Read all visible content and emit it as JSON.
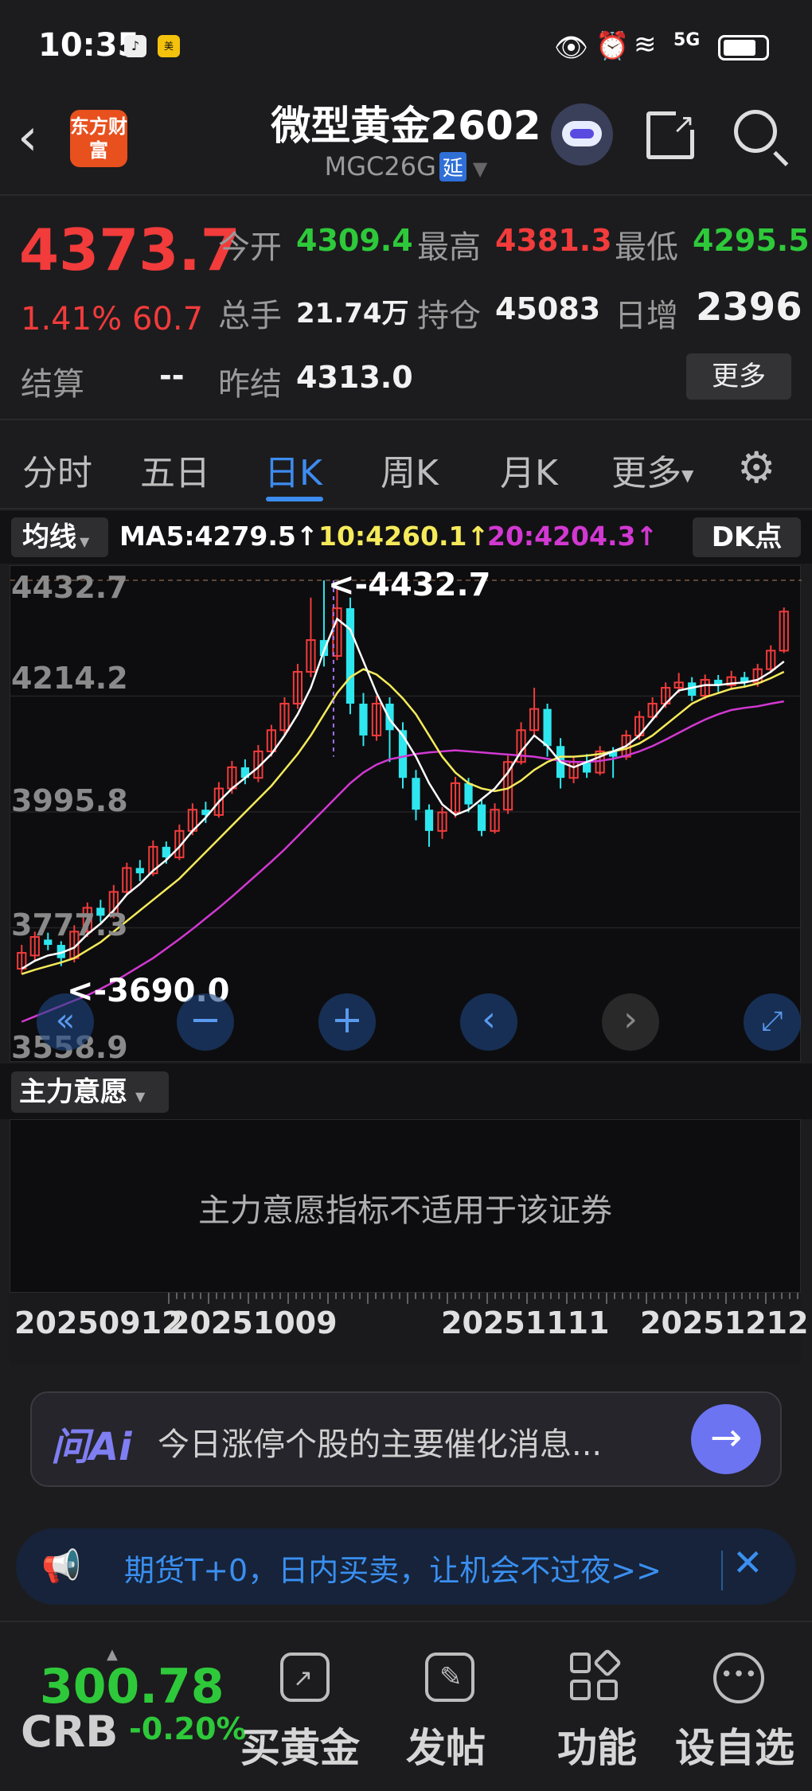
{
  "status": {
    "time": "10:35",
    "network": "5G"
  },
  "header": {
    "title": "微型黄金2602",
    "symbol": "MGC26G",
    "badge": "延",
    "logo_text": "东方财富"
  },
  "quote": {
    "price": "4373.7",
    "change_pct": "1.41%",
    "change": "60.7",
    "open_label": "今开",
    "open": "4309.4",
    "high_label": "最高",
    "high": "4381.3",
    "low_label": "最低",
    "low": "4295.5",
    "volume_label": "总手",
    "volume": "21.74万",
    "oi_label": "持仓",
    "oi": "45083",
    "daily_inc_label": "日增",
    "daily_inc": "2396",
    "settle_label": "结算",
    "settle": "--",
    "prev_settle_label": "昨结",
    "prev_settle": "4313.0",
    "more_label": "更多"
  },
  "tabs": [
    "分时",
    "五日",
    "日K",
    "周K",
    "月K",
    "更多"
  ],
  "active_tab": "日K",
  "ma": {
    "button": "均线",
    "ma5": "MA5:4279.5",
    "ma10": "10:4260.1",
    "ma20": "20:4204.3",
    "dk": "DK点"
  },
  "colors": {
    "up": "#f23b3b",
    "down": "#2ee6ee",
    "ma5": "#ffffff",
    "ma10": "#f5ea5a",
    "ma20": "#d238d2",
    "accent": "#3d8cf0"
  },
  "chart_data": {
    "type": "candlestick",
    "y_ticks": [
      "4432.7",
      "4214.2",
      "3995.8",
      "3777.3",
      "3558.9"
    ],
    "ylim": [
      3558.9,
      4432.7
    ],
    "max_marker": "<-4432.7",
    "min_marker": "<-3690.0",
    "x_ticks": [
      "20250912",
      "20251009",
      "20251111",
      "20251212"
    ],
    "candles": [
      [
        3700,
        3730,
        3690,
        3745
      ],
      [
        3725,
        3760,
        3715,
        3770
      ],
      [
        3755,
        3745,
        3735,
        3768
      ],
      [
        3745,
        3720,
        3705,
        3752
      ],
      [
        3720,
        3770,
        3712,
        3782
      ],
      [
        3770,
        3815,
        3760,
        3825
      ],
      [
        3815,
        3800,
        3788,
        3830
      ],
      [
        3800,
        3845,
        3795,
        3858
      ],
      [
        3845,
        3890,
        3838,
        3900
      ],
      [
        3890,
        3880,
        3865,
        3905
      ],
      [
        3880,
        3930,
        3875,
        3942
      ],
      [
        3930,
        3910,
        3898,
        3940
      ],
      [
        3910,
        3960,
        3905,
        3972
      ],
      [
        3960,
        4000,
        3952,
        4012
      ],
      [
        4000,
        3990,
        3975,
        4015
      ],
      [
        3990,
        4040,
        3985,
        4052
      ],
      [
        4040,
        4080,
        4030,
        4092
      ],
      [
        4080,
        4060,
        4048,
        4095
      ],
      [
        4060,
        4110,
        4052,
        4122
      ],
      [
        4110,
        4150,
        4100,
        4160
      ],
      [
        4150,
        4200,
        4140,
        4212
      ],
      [
        4200,
        4260,
        4190,
        4275
      ],
      [
        4260,
        4320,
        4250,
        4400
      ],
      [
        4320,
        4290,
        4270,
        4432.7
      ],
      [
        4290,
        4380,
        4282,
        4420
      ],
      [
        4380,
        4200,
        4180,
        4400
      ],
      [
        4200,
        4140,
        4120,
        4220
      ],
      [
        4140,
        4200,
        4130,
        4215
      ],
      [
        4200,
        4150,
        4090,
        4212
      ],
      [
        4150,
        4060,
        4040,
        4165
      ],
      [
        4060,
        4000,
        3980,
        4075
      ],
      [
        4000,
        3960,
        3930,
        4010
      ],
      [
        3960,
        3995,
        3945,
        4005
      ],
      [
        3995,
        4050,
        3985,
        4062
      ],
      [
        4050,
        4010,
        3995,
        4060
      ],
      [
        4010,
        3960,
        3950,
        4020
      ],
      [
        3960,
        4000,
        3955,
        4012
      ],
      [
        4000,
        4090,
        3992,
        4102
      ],
      [
        4090,
        4150,
        4085,
        4165
      ],
      [
        4150,
        4190,
        4140,
        4230
      ],
      [
        4190,
        4120,
        4100,
        4200
      ],
      [
        4120,
        4060,
        4040,
        4135
      ],
      [
        4060,
        4090,
        4050,
        4100
      ],
      [
        4090,
        4070,
        4060,
        4105
      ],
      [
        4070,
        4110,
        4065,
        4120
      ],
      [
        4110,
        4100,
        4060,
        4118
      ],
      [
        4100,
        4140,
        4094,
        4150
      ],
      [
        4140,
        4175,
        4132,
        4186
      ],
      [
        4175,
        4200,
        4168,
        4212
      ],
      [
        4200,
        4230,
        4192,
        4240
      ],
      [
        4230,
        4240,
        4220,
        4258
      ],
      [
        4240,
        4215,
        4205,
        4250
      ],
      [
        4215,
        4245,
        4208,
        4255
      ],
      [
        4245,
        4235,
        4222,
        4254
      ],
      [
        4235,
        4250,
        4226,
        4262
      ],
      [
        4250,
        4240,
        4230,
        4260
      ],
      [
        4240,
        4265,
        4232,
        4275
      ],
      [
        4265,
        4300,
        4258,
        4310
      ],
      [
        4300,
        4373.7,
        4295.5,
        4381.3
      ]
    ],
    "ma5": [
      3700,
      3715,
      3725,
      3730,
      3740,
      3765,
      3785,
      3810,
      3840,
      3860,
      3885,
      3905,
      3930,
      3960,
      3985,
      4015,
      4040,
      4060,
      4080,
      4105,
      4140,
      4180,
      4230,
      4300,
      4360,
      4340,
      4280,
      4220,
      4170,
      4140,
      4100,
      4050,
      4010,
      3990,
      4000,
      4020,
      4040,
      4070,
      4110,
      4140,
      4120,
      4090,
      4080,
      4090,
      4100,
      4110,
      4120,
      4140,
      4170,
      4200,
      4225,
      4230,
      4235,
      4235,
      4238,
      4240,
      4245,
      4260,
      4279.5
    ],
    "ma10": [
      3690,
      3698,
      3705,
      3712,
      3720,
      3735,
      3750,
      3770,
      3790,
      3810,
      3830,
      3850,
      3870,
      3895,
      3920,
      3945,
      3970,
      3995,
      4020,
      4045,
      4075,
      4105,
      4140,
      4180,
      4220,
      4250,
      4265,
      4255,
      4235,
      4210,
      4180,
      4140,
      4100,
      4070,
      4050,
      4040,
      4035,
      4040,
      4055,
      4075,
      4090,
      4100,
      4100,
      4102,
      4105,
      4110,
      4115,
      4125,
      4140,
      4160,
      4180,
      4200,
      4212,
      4220,
      4228,
      4232,
      4238,
      4248,
      4260.1
    ],
    "ma20": [
      3600,
      3610,
      3620,
      3630,
      3640,
      3650,
      3662,
      3675,
      3690,
      3705,
      3720,
      3738,
      3756,
      3775,
      3795,
      3815,
      3836,
      3858,
      3880,
      3902,
      3925,
      3950,
      3975,
      4000,
      4025,
      4050,
      4070,
      4085,
      4095,
      4100,
      4105,
      4108,
      4110,
      4112,
      4110,
      4108,
      4106,
      4104,
      4102,
      4100,
      4096,
      4092,
      4090,
      4090,
      4092,
      4096,
      4102,
      4110,
      4120,
      4132,
      4145,
      4158,
      4170,
      4180,
      4188,
      4192,
      4195,
      4200,
      4204.3
    ]
  },
  "sub_panel": {
    "button": "主力意愿",
    "message": "主力意愿指标不适用于该证券"
  },
  "ai": {
    "logo": "问Ai",
    "placeholder": "今日涨停个股的主要催化消息..."
  },
  "promo": {
    "text": "期货T+0，日内买卖，让机会不过夜>>"
  },
  "bottom": {
    "index_value": "300.78",
    "index_name": "CRB",
    "index_change": "-0.20%",
    "items": [
      "买黄金",
      "发帖",
      "功能",
      "设自选"
    ]
  }
}
